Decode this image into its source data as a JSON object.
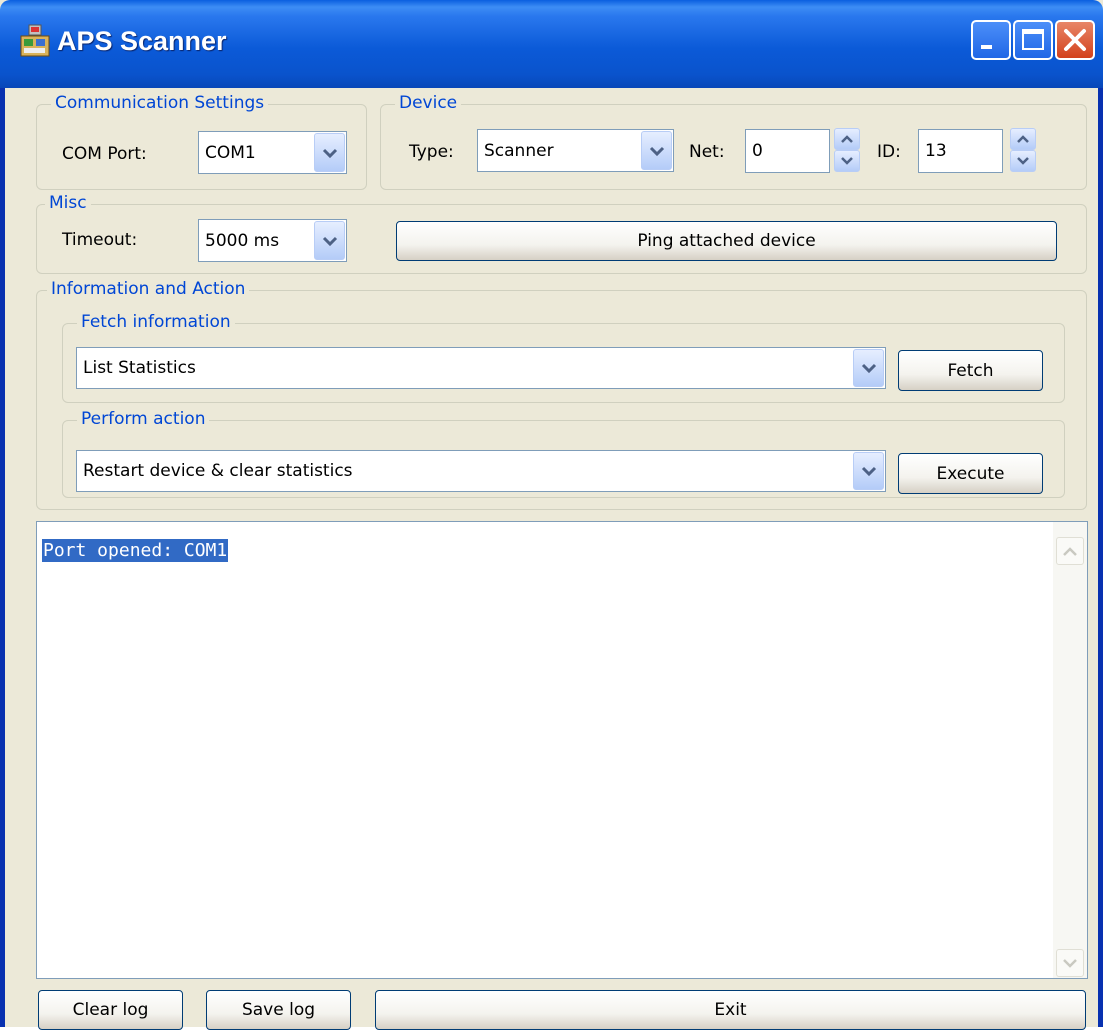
{
  "window": {
    "title": "APS Scanner",
    "icon": "aps-app-icon",
    "controls": [
      "minimize-icon",
      "maximize-icon",
      "close-icon"
    ]
  },
  "communication": {
    "legend": "Communication Settings",
    "com_port_label": "COM Port:",
    "com_port_value": "COM1"
  },
  "device": {
    "legend": "Device",
    "type_label": "Type:",
    "type_value": "Scanner",
    "net_label": "Net:",
    "net_value": "0",
    "id_label": "ID:",
    "id_value": "13"
  },
  "misc": {
    "legend": "Misc",
    "timeout_label": "Timeout:",
    "timeout_value": "5000 ms",
    "ping_button": "Ping attached device"
  },
  "info_action": {
    "legend": "Information and Action",
    "fetch": {
      "legend": "Fetch information",
      "selected": "List Statistics",
      "button": "Fetch"
    },
    "action": {
      "legend": "Perform action",
      "selected": "Restart device & clear statistics",
      "button": "Execute"
    }
  },
  "log": {
    "lines": [
      "Port opened: COM1"
    ]
  },
  "footer": {
    "clear_log": "Clear log",
    "save_log": "Save log",
    "exit": "Exit"
  },
  "colors": {
    "titlebar": "#0a5fe0",
    "legend_text": "#0046d5",
    "window_bg": "#ece9d8",
    "selection": "#316ac5"
  }
}
